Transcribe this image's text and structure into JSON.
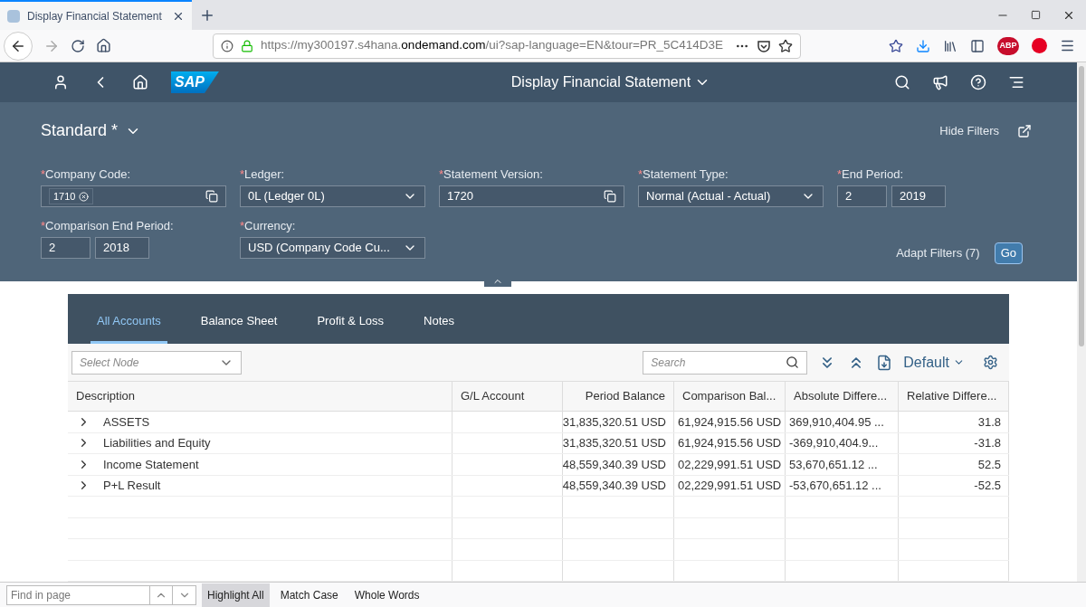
{
  "browser": {
    "tab_title": "Display Financial Statement",
    "url": "https://my300197.s4hana.**ondemand.com**/ui?sap-language=EN&tour=PR_5C414D3E",
    "abp_badge": "ABP"
  },
  "shell": {
    "logo": "SAP",
    "title": "Display Financial Statement"
  },
  "filter_bar": {
    "variant": "Standard *",
    "hide_filters": "Hide Filters",
    "adapt_filters": "Adapt Filters (7)",
    "go": "Go",
    "filters": [
      {
        "kind": "tokens",
        "mark": "*",
        "label": "Company Code:",
        "tokens": [
          "1710"
        ]
      },
      {
        "kind": "select",
        "mark": "*",
        "label": "Ledger:",
        "value": "0L (Ledger 0L)"
      },
      {
        "kind": "valuehelp",
        "mark": "*",
        "label": "Statement Version:",
        "value": "1720"
      },
      {
        "kind": "select",
        "mark": "*",
        "label": "Statement Type:",
        "value": "Normal (Actual - Actual)"
      },
      {
        "kind": "period",
        "mark": "*",
        "label": "End Period:",
        "values": [
          "2",
          "2019"
        ]
      },
      {
        "kind": "period",
        "mark": "*",
        "label": "Comparison End Period:",
        "values": [
          "2",
          "2018"
        ]
      },
      {
        "kind": "select",
        "mark": "*",
        "label": "Currency:",
        "value": "USD (Company Code Cu..."
      }
    ]
  },
  "tabs": [
    {
      "label": "All Accounts",
      "selected": true
    },
    {
      "label": "Balance Sheet",
      "selected": false
    },
    {
      "label": "Profit & Loss",
      "selected": false
    },
    {
      "label": "Notes",
      "selected": false
    }
  ],
  "toolbar": {
    "node_placeholder": "Select Node",
    "search_placeholder": "Search",
    "variant": "Default"
  },
  "table": {
    "columns": [
      "Description",
      "G/L Account",
      "Period Balance",
      "Comparison Bal...",
      "Absolute Differe...",
      "Relative Differe..."
    ],
    "rows": [
      [
        "ASSETS",
        "",
        "31,835,320.51 USD",
        "61,924,915.56 USD",
        "369,910,404.95 ...",
        "31.8"
      ],
      [
        "Liabilities and Equity",
        "",
        "31,835,320.51 USD",
        "61,924,915.56 USD",
        "-369,910,404.9...",
        "-31.8"
      ],
      [
        "Income Statement",
        "",
        "48,559,340.39 USD",
        "02,229,991.51 USD",
        "53,670,651.12 ...",
        "52.5"
      ],
      [
        "P+L Result",
        "",
        "48,559,340.39 USD",
        "02,229,991.51 USD",
        "-53,670,651.12 ...",
        "-52.5"
      ]
    ]
  },
  "find_bar": {
    "placeholder": "Find in page",
    "options": [
      {
        "label": "Highlight All",
        "pressed": true
      },
      {
        "label": "Match Case",
        "pressed": false
      },
      {
        "label": "Whole Words",
        "pressed": false
      }
    ]
  }
}
